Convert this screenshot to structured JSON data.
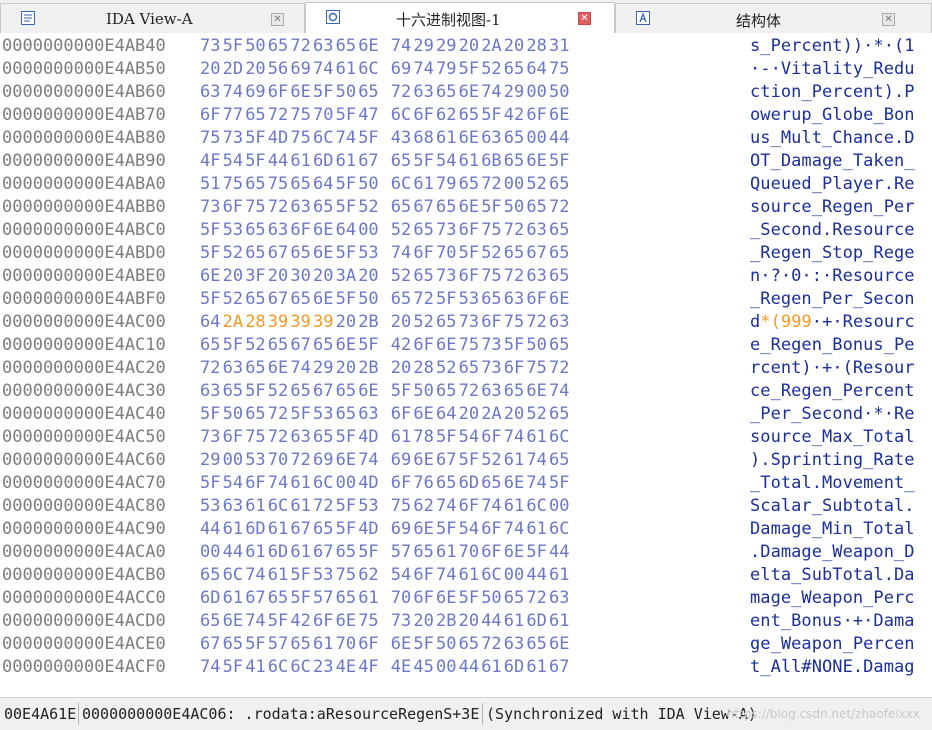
{
  "tabs": [
    {
      "label": "IDA View-A",
      "icon": "listing-view-icon",
      "active": false
    },
    {
      "label": "十六进制视图-1",
      "icon": "hex-view-icon",
      "active": true
    },
    {
      "label": "结构体",
      "icon": "structures-icon",
      "active": false
    }
  ],
  "close_glyph": "✕",
  "hex_rows": [
    {
      "addr": "0000000000E4AB40",
      "bytes": [
        "73",
        "5F",
        "50",
        "65",
        "72",
        "63",
        "65",
        "6E",
        "74",
        "29",
        "29",
        "20",
        "2A",
        "20",
        "28",
        "31"
      ],
      "ascii": "s_Percent))·*·(1"
    },
    {
      "addr": "0000000000E4AB50",
      "bytes": [
        "20",
        "2D",
        "20",
        "56",
        "69",
        "74",
        "61",
        "6C",
        "69",
        "74",
        "79",
        "5F",
        "52",
        "65",
        "64",
        "75"
      ],
      "ascii": "·-·Vitality_Redu"
    },
    {
      "addr": "0000000000E4AB60",
      "bytes": [
        "63",
        "74",
        "69",
        "6F",
        "6E",
        "5F",
        "50",
        "65",
        "72",
        "63",
        "65",
        "6E",
        "74",
        "29",
        "00",
        "50"
      ],
      "ascii": "ction_Percent).P"
    },
    {
      "addr": "0000000000E4AB70",
      "bytes": [
        "6F",
        "77",
        "65",
        "72",
        "75",
        "70",
        "5F",
        "47",
        "6C",
        "6F",
        "62",
        "65",
        "5F",
        "42",
        "6F",
        "6E"
      ],
      "ascii": "owerup_Globe_Bon"
    },
    {
      "addr": "0000000000E4AB80",
      "bytes": [
        "75",
        "73",
        "5F",
        "4D",
        "75",
        "6C",
        "74",
        "5F",
        "43",
        "68",
        "61",
        "6E",
        "63",
        "65",
        "00",
        "44"
      ],
      "ascii": "us_Mult_Chance.D"
    },
    {
      "addr": "0000000000E4AB90",
      "bytes": [
        "4F",
        "54",
        "5F",
        "44",
        "61",
        "6D",
        "61",
        "67",
        "65",
        "5F",
        "54",
        "61",
        "6B",
        "65",
        "6E",
        "5F"
      ],
      "ascii": "OT_Damage_Taken_"
    },
    {
      "addr": "0000000000E4ABA0",
      "bytes": [
        "51",
        "75",
        "65",
        "75",
        "65",
        "64",
        "5F",
        "50",
        "6C",
        "61",
        "79",
        "65",
        "72",
        "00",
        "52",
        "65"
      ],
      "ascii": "Queued_Player.Re"
    },
    {
      "addr": "0000000000E4ABB0",
      "bytes": [
        "73",
        "6F",
        "75",
        "72",
        "63",
        "65",
        "5F",
        "52",
        "65",
        "67",
        "65",
        "6E",
        "5F",
        "50",
        "65",
        "72"
      ],
      "ascii": "source_Regen_Per"
    },
    {
      "addr": "0000000000E4ABC0",
      "bytes": [
        "5F",
        "53",
        "65",
        "63",
        "6F",
        "6E",
        "64",
        "00",
        "52",
        "65",
        "73",
        "6F",
        "75",
        "72",
        "63",
        "65"
      ],
      "ascii": "_Second.Resource"
    },
    {
      "addr": "0000000000E4ABD0",
      "bytes": [
        "5F",
        "52",
        "65",
        "67",
        "65",
        "6E",
        "5F",
        "53",
        "74",
        "6F",
        "70",
        "5F",
        "52",
        "65",
        "67",
        "65"
      ],
      "ascii": "_Regen_Stop_Rege"
    },
    {
      "addr": "0000000000E4ABE0",
      "bytes": [
        "6E",
        "20",
        "3F",
        "20",
        "30",
        "20",
        "3A",
        "20",
        "52",
        "65",
        "73",
        "6F",
        "75",
        "72",
        "63",
        "65"
      ],
      "ascii": "n·?·0·:·Resource"
    },
    {
      "addr": "0000000000E4ABF0",
      "bytes": [
        "5F",
        "52",
        "65",
        "67",
        "65",
        "6E",
        "5F",
        "50",
        "65",
        "72",
        "5F",
        "53",
        "65",
        "63",
        "6F",
        "6E"
      ],
      "ascii": "_Regen_Per_Secon"
    },
    {
      "addr": "0000000000E4AC00",
      "bytes": [
        "64",
        "2A",
        "28",
        "39",
        "39",
        "39",
        "20",
        "2B",
        "20",
        "52",
        "65",
        "73",
        "6F",
        "75",
        "72",
        "63"
      ],
      "ascii": "d*(999·+·Resourc",
      "highlight": [
        1,
        2,
        3,
        4,
        5
      ]
    },
    {
      "addr": "0000000000E4AC10",
      "bytes": [
        "65",
        "5F",
        "52",
        "65",
        "67",
        "65",
        "6E",
        "5F",
        "42",
        "6F",
        "6E",
        "75",
        "73",
        "5F",
        "50",
        "65"
      ],
      "ascii": "e_Regen_Bonus_Pe"
    },
    {
      "addr": "0000000000E4AC20",
      "bytes": [
        "72",
        "63",
        "65",
        "6E",
        "74",
        "29",
        "20",
        "2B",
        "20",
        "28",
        "52",
        "65",
        "73",
        "6F",
        "75",
        "72"
      ],
      "ascii": "rcent)·+·(Resour"
    },
    {
      "addr": "0000000000E4AC30",
      "bytes": [
        "63",
        "65",
        "5F",
        "52",
        "65",
        "67",
        "65",
        "6E",
        "5F",
        "50",
        "65",
        "72",
        "63",
        "65",
        "6E",
        "74"
      ],
      "ascii": "ce_Regen_Percent"
    },
    {
      "addr": "0000000000E4AC40",
      "bytes": [
        "5F",
        "50",
        "65",
        "72",
        "5F",
        "53",
        "65",
        "63",
        "6F",
        "6E",
        "64",
        "20",
        "2A",
        "20",
        "52",
        "65"
      ],
      "ascii": "_Per_Second·*·Re"
    },
    {
      "addr": "0000000000E4AC50",
      "bytes": [
        "73",
        "6F",
        "75",
        "72",
        "63",
        "65",
        "5F",
        "4D",
        "61",
        "78",
        "5F",
        "54",
        "6F",
        "74",
        "61",
        "6C"
      ],
      "ascii": "source_Max_Total"
    },
    {
      "addr": "0000000000E4AC60",
      "bytes": [
        "29",
        "00",
        "53",
        "70",
        "72",
        "69",
        "6E",
        "74",
        "69",
        "6E",
        "67",
        "5F",
        "52",
        "61",
        "74",
        "65"
      ],
      "ascii": ").Sprinting_Rate"
    },
    {
      "addr": "0000000000E4AC70",
      "bytes": [
        "5F",
        "54",
        "6F",
        "74",
        "61",
        "6C",
        "00",
        "4D",
        "6F",
        "76",
        "65",
        "6D",
        "65",
        "6E",
        "74",
        "5F"
      ],
      "ascii": "_Total.Movement_"
    },
    {
      "addr": "0000000000E4AC80",
      "bytes": [
        "53",
        "63",
        "61",
        "6C",
        "61",
        "72",
        "5F",
        "53",
        "75",
        "62",
        "74",
        "6F",
        "74",
        "61",
        "6C",
        "00"
      ],
      "ascii": "Scalar_Subtotal."
    },
    {
      "addr": "0000000000E4AC90",
      "bytes": [
        "44",
        "61",
        "6D",
        "61",
        "67",
        "65",
        "5F",
        "4D",
        "69",
        "6E",
        "5F",
        "54",
        "6F",
        "74",
        "61",
        "6C"
      ],
      "ascii": "Damage_Min_Total"
    },
    {
      "addr": "0000000000E4ACA0",
      "bytes": [
        "00",
        "44",
        "61",
        "6D",
        "61",
        "67",
        "65",
        "5F",
        "57",
        "65",
        "61",
        "70",
        "6F",
        "6E",
        "5F",
        "44"
      ],
      "ascii": ".Damage_Weapon_D"
    },
    {
      "addr": "0000000000E4ACB0",
      "bytes": [
        "65",
        "6C",
        "74",
        "61",
        "5F",
        "53",
        "75",
        "62",
        "54",
        "6F",
        "74",
        "61",
        "6C",
        "00",
        "44",
        "61"
      ],
      "ascii": "elta_SubTotal.Da"
    },
    {
      "addr": "0000000000E4ACC0",
      "bytes": [
        "6D",
        "61",
        "67",
        "65",
        "5F",
        "57",
        "65",
        "61",
        "70",
        "6F",
        "6E",
        "5F",
        "50",
        "65",
        "72",
        "63"
      ],
      "ascii": "mage_Weapon_Perc"
    },
    {
      "addr": "0000000000E4ACD0",
      "bytes": [
        "65",
        "6E",
        "74",
        "5F",
        "42",
        "6F",
        "6E",
        "75",
        "73",
        "20",
        "2B",
        "20",
        "44",
        "61",
        "6D",
        "61"
      ],
      "ascii": "ent_Bonus·+·Dama"
    },
    {
      "addr": "0000000000E4ACE0",
      "bytes": [
        "67",
        "65",
        "5F",
        "57",
        "65",
        "61",
        "70",
        "6F",
        "6E",
        "5F",
        "50",
        "65",
        "72",
        "63",
        "65",
        "6E"
      ],
      "ascii": "ge_Weapon_Percen"
    },
    {
      "addr": "0000000000E4ACF0",
      "bytes": [
        "74",
        "5F",
        "41",
        "6C",
        "6C",
        "23",
        "4E",
        "4F",
        "4E",
        "45",
        "00",
        "44",
        "61",
        "6D",
        "61",
        "67"
      ],
      "ascii": "t_All#NONE.Damag"
    }
  ],
  "status": {
    "offset": "00E4A61E",
    "location": "0000000000E4AC06: .rodata:aResourceRegenS+3E",
    "sync": "(Synchronized with IDA View-A)"
  },
  "watermark": "https://blog.csdn.net/zhaofeixxx",
  "colors": {
    "address": "#7d7d7d",
    "hex": "#6b78c8",
    "ascii": "#1a2f9a",
    "highlight": "#f29a24"
  }
}
